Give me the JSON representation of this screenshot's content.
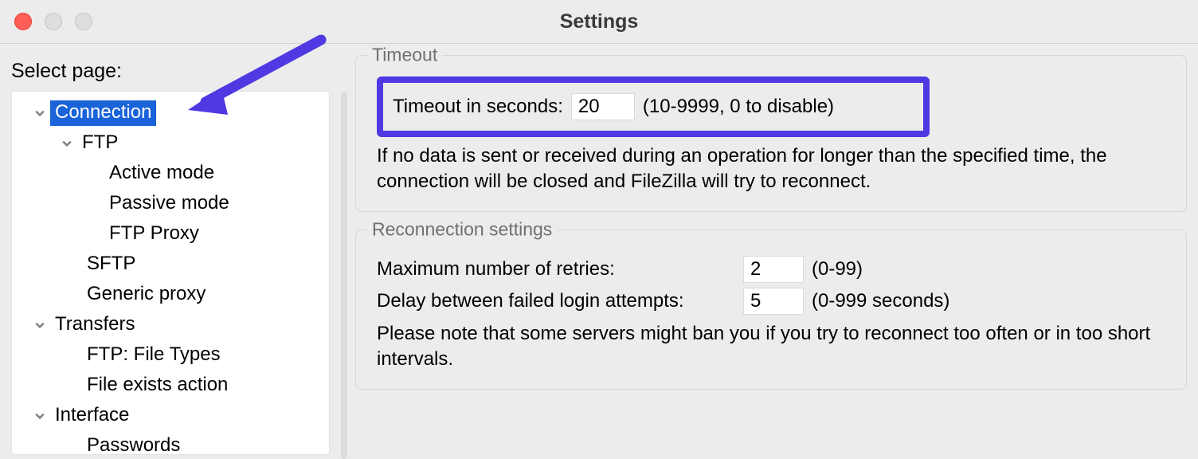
{
  "window": {
    "title": "Settings"
  },
  "sidebar": {
    "heading": "Select page:",
    "items": [
      {
        "label": "Connection",
        "depth": 0,
        "expandable": true,
        "selected": true
      },
      {
        "label": "FTP",
        "depth": 1,
        "expandable": true
      },
      {
        "label": "Active mode",
        "depth": 2
      },
      {
        "label": "Passive mode",
        "depth": 2
      },
      {
        "label": "FTP Proxy",
        "depth": 2
      },
      {
        "label": "SFTP",
        "depth": 1
      },
      {
        "label": "Generic proxy",
        "depth": 1
      },
      {
        "label": "Transfers",
        "depth": 0,
        "expandable": true
      },
      {
        "label": "FTP: File Types",
        "depth": 1
      },
      {
        "label": "File exists action",
        "depth": 1
      },
      {
        "label": "Interface",
        "depth": 0,
        "expandable": true
      },
      {
        "label": "Passwords",
        "depth": 1
      }
    ]
  },
  "groups": {
    "timeout": {
      "legend": "Timeout",
      "row_label": "Timeout in seconds:",
      "value": "20",
      "range": "(10-9999, 0 to disable)",
      "desc": "If no data is sent or received during an operation for longer than the specified time, the connection will be closed and FileZilla will try to reconnect."
    },
    "reconnect": {
      "legend": "Reconnection settings",
      "retries_label": "Maximum number of retries:",
      "retries_value": "2",
      "retries_range": "(0-99)",
      "delay_label": "Delay between failed login attempts:",
      "delay_value": "5",
      "delay_range": "(0-999 seconds)",
      "desc": "Please note that some servers might ban you if you try to reconnect too often or in too short intervals."
    }
  }
}
